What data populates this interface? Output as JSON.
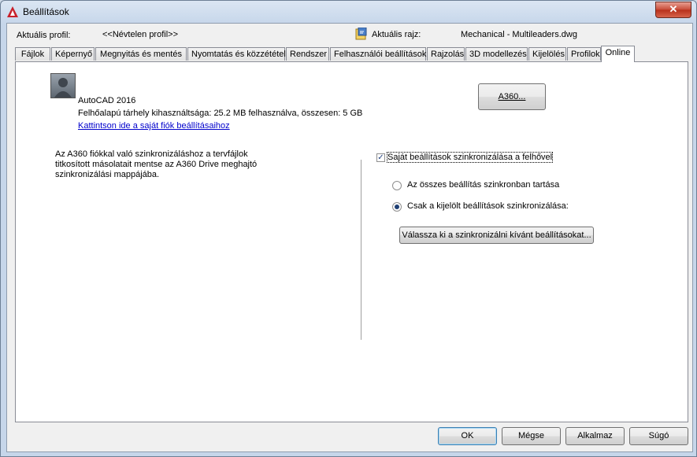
{
  "window": {
    "title": "Beállítások",
    "close_glyph": "✕"
  },
  "header": {
    "profile_label": "Aktuális profil:",
    "profile_value": "<<Névtelen profil>>",
    "drawing_label": "Aktuális rajz:",
    "drawing_value": "Mechanical - Multileaders.dwg"
  },
  "tabs": [
    {
      "label": "Fájlok"
    },
    {
      "label": "Képernyő"
    },
    {
      "label": "Megnyitás és mentés"
    },
    {
      "label": "Nyomtatás és közzététel"
    },
    {
      "label": "Rendszer"
    },
    {
      "label": "Felhasználói beállítások"
    },
    {
      "label": "Rajzolás"
    },
    {
      "label": "3D modellezés"
    },
    {
      "label": "Kijelölés"
    },
    {
      "label": "Profilok"
    },
    {
      "label": "Online"
    }
  ],
  "online": {
    "product": "AutoCAD 2016",
    "storage": "Felhőalapú tárhely kihasználtsága: 25.2 MB felhasználva, összesen: 5 GB",
    "account_link": "Kattintson ide a saját fiók beállításaihoz",
    "a360_button": "A360...",
    "sync_info_1": "Az A360 fiókkal való szinkronizáláshoz a tervfájlok",
    "sync_info_2": "titkosított másolatait mentse az A360 Drive meghajtó",
    "sync_info_3": "szinkronizálási mappájába.",
    "sync_checkbox": "Saját beállítások szinkronizálása a felhővel",
    "sync_checked": true,
    "radio_all": "Az összes beállítás szinkronban tartása",
    "radio_selected": "Csak a kijelölt beállítások szinkronizálása:",
    "selected_option": "radio_selected",
    "choose_button": "Válassza ki a szinkronizálni kívánt beállításokat..."
  },
  "footer": {
    "ok": "OK",
    "cancel": "Mégse",
    "apply": "Alkalmaz",
    "help": "Súgó"
  }
}
